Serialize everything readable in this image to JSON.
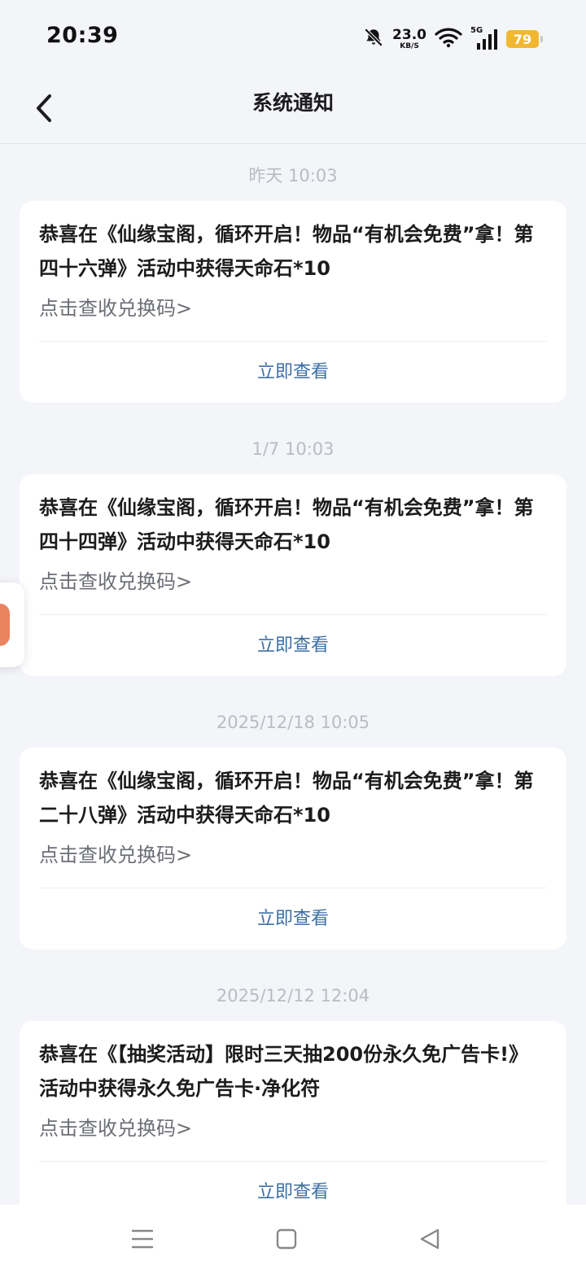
{
  "status_bar": {
    "time": "20:39",
    "net_speed_value": "23.0",
    "net_speed_unit": "KB/S",
    "network_type": "5G",
    "battery_level": "79",
    "battery_color": "#f2b731"
  },
  "nav": {
    "title": "系统通知",
    "back_icon": "chevron-left-icon"
  },
  "messages": [
    {
      "time": "昨天  10:03",
      "title": "恭喜在《仙缘宝阁，循环开启！物品“有机会免费”拿！第四十六弹》活动中获得天命石*10",
      "link": "点击查收兑换码>",
      "action": "立即查看"
    },
    {
      "time": "1/7  10:03",
      "title": "恭喜在《仙缘宝阁，循环开启！物品“有机会免费”拿！第四十四弹》活动中获得天命石*10",
      "link": "点击查收兑换码>",
      "action": "立即查看"
    },
    {
      "time": "2025/12/18  10:05",
      "title": "恭喜在《仙缘宝阁，循环开启！物品“有机会免费”拿！第二十八弹》活动中获得天命石*10",
      "link": "点击查收兑换码>",
      "action": "立即查看"
    },
    {
      "time": "2025/12/12  12:04",
      "title": "恭喜在《【抽奖活动】限时三天抽200份永久免广告卡!》活动中获得永久免广告卡·净化符",
      "link": "点击查收兑换码>",
      "action": "立即查看"
    }
  ],
  "colors": {
    "background": "#f4f5f9",
    "card": "#ffffff",
    "action_blue": "#3d6fa5",
    "time_gray": "#b9bcc4"
  },
  "bottom_nav": {
    "menu_icon": "menu-icon",
    "home_icon": "square-home-icon",
    "back_icon": "triangle-back-icon"
  }
}
